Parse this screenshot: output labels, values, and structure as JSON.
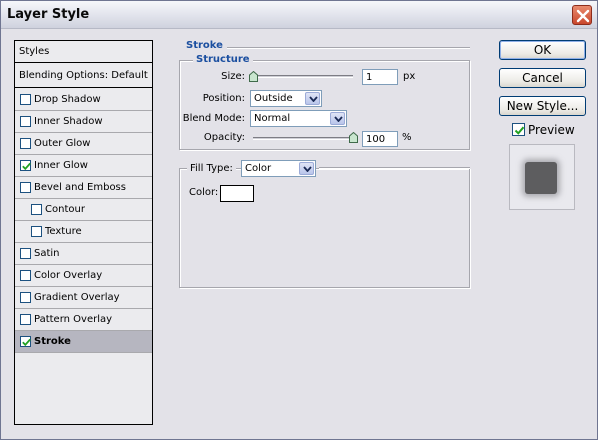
{
  "window": {
    "title": "Layer Style"
  },
  "sidebar": {
    "header": "Styles",
    "blending": "Blending Options: Default",
    "items": [
      {
        "label": "Drop Shadow",
        "checked": false,
        "sub": false,
        "selected": false
      },
      {
        "label": "Inner Shadow",
        "checked": false,
        "sub": false,
        "selected": false
      },
      {
        "label": "Outer Glow",
        "checked": false,
        "sub": false,
        "selected": false
      },
      {
        "label": "Inner Glow",
        "checked": true,
        "sub": false,
        "selected": false
      },
      {
        "label": "Bevel and Emboss",
        "checked": false,
        "sub": false,
        "selected": false
      },
      {
        "label": "Contour",
        "checked": false,
        "sub": true,
        "selected": false
      },
      {
        "label": "Texture",
        "checked": false,
        "sub": true,
        "selected": false
      },
      {
        "label": "Satin",
        "checked": false,
        "sub": false,
        "selected": false
      },
      {
        "label": "Color Overlay",
        "checked": false,
        "sub": false,
        "selected": false
      },
      {
        "label": "Gradient Overlay",
        "checked": false,
        "sub": false,
        "selected": false
      },
      {
        "label": "Pattern Overlay",
        "checked": false,
        "sub": false,
        "selected": false
      },
      {
        "label": "Stroke",
        "checked": true,
        "sub": false,
        "selected": true
      }
    ]
  },
  "stroke": {
    "title": "Stroke",
    "structure": {
      "title": "Structure",
      "size_label": "Size:",
      "size_value": "1",
      "size_unit": "px",
      "size_slider_fraction": 0.0,
      "position_label": "Position:",
      "position_value": "Outside",
      "blend_label": "Blend Mode:",
      "blend_value": "Normal",
      "opacity_label": "Opacity:",
      "opacity_value": "100",
      "opacity_unit": "%",
      "opacity_slider_fraction": 1.0
    },
    "fill": {
      "type_label": "Fill Type:",
      "type_value": "Color",
      "color_label": "Color:",
      "color_value": "#ffffff"
    }
  },
  "buttons": {
    "ok": "OK",
    "cancel": "Cancel",
    "new_style": "New Style..."
  },
  "preview": {
    "label": "Preview",
    "checked": true
  }
}
